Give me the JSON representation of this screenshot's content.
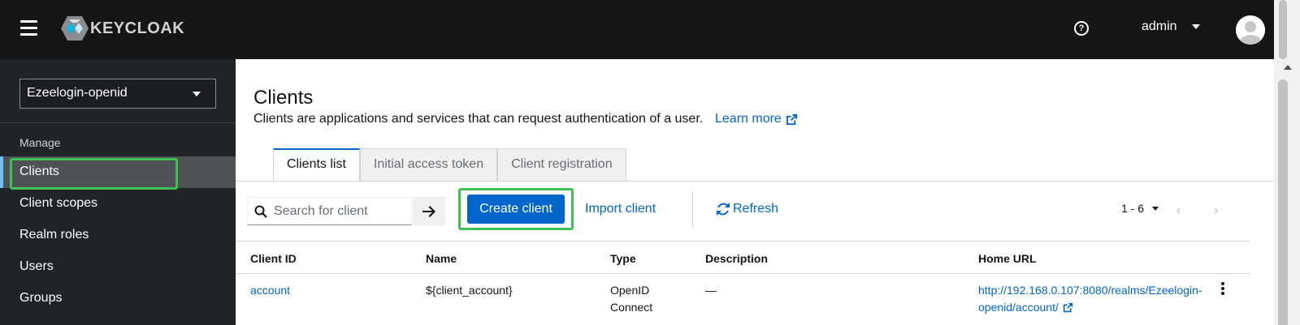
{
  "header": {
    "logo_text": "KEYCLOAK",
    "help_icon_glyph": "?",
    "username": "admin"
  },
  "sidebar": {
    "realm": "Ezeelogin-openid",
    "section_label": "Manage",
    "items": [
      {
        "label": "Clients",
        "active": true
      },
      {
        "label": "Client scopes"
      },
      {
        "label": "Realm roles"
      },
      {
        "label": "Users"
      },
      {
        "label": "Groups"
      }
    ]
  },
  "page": {
    "title": "Clients",
    "description": "Clients are applications and services that can request authentication of a user.",
    "learn_more": "Learn more"
  },
  "tabs": [
    {
      "label": "Clients list",
      "active": true
    },
    {
      "label": "Initial access token"
    },
    {
      "label": "Client registration"
    }
  ],
  "toolbar": {
    "search_placeholder": "Search for client",
    "create_label": "Create client",
    "import_label": "Import client",
    "refresh_label": "Refresh",
    "pagination": "1 - 6",
    "prev_glyph": "‹",
    "next_glyph": "›"
  },
  "table": {
    "columns": [
      "Client ID",
      "Name",
      "Type",
      "Description",
      "Home URL"
    ],
    "rows": [
      {
        "client_id": "account",
        "name": "${client_account}",
        "type_line1": "OpenID",
        "type_line2": "Connect",
        "description": "—",
        "home_url_line1": "http://192.168.0.107:8080/realms/Ezeelogin-",
        "home_url_line2": "openid/account/"
      }
    ]
  },
  "colors": {
    "accent": "#0066cc",
    "highlight": "#3fc152",
    "header_bg": "#151515",
    "sidebar_bg": "#212427"
  }
}
